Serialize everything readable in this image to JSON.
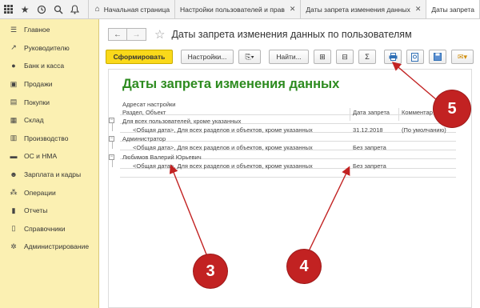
{
  "tabs": [
    {
      "label": "Начальная страница",
      "icon": "home-icon"
    },
    {
      "label": "Настройки пользователей и прав",
      "icon": "",
      "close": "✕"
    },
    {
      "label": "Даты запрета изменения данных",
      "icon": "",
      "close": "✕"
    },
    {
      "label": "Даты запрета",
      "icon": ""
    }
  ],
  "sidebar": {
    "items": [
      {
        "label": "Главное",
        "icon": "menu-icon"
      },
      {
        "label": "Руководителю",
        "icon": "trend-icon"
      },
      {
        "label": "Банк и касса",
        "icon": "coin-icon"
      },
      {
        "label": "Продажи",
        "icon": "cart-icon"
      },
      {
        "label": "Покупки",
        "icon": "basket-icon"
      },
      {
        "label": "Склад",
        "icon": "warehouse-icon"
      },
      {
        "label": "Производство",
        "icon": "production-icon"
      },
      {
        "label": "ОС и НМА",
        "icon": "assets-icon"
      },
      {
        "label": "Зарплата и кадры",
        "icon": "people-icon"
      },
      {
        "label": "Операции",
        "icon": "operations-icon"
      },
      {
        "label": "Отчеты",
        "icon": "reports-icon"
      },
      {
        "label": "Справочники",
        "icon": "books-icon"
      },
      {
        "label": "Администрирование",
        "icon": "gear-icon"
      }
    ]
  },
  "header": {
    "title": "Даты запрета изменения данных по пользователям"
  },
  "toolbar": {
    "generate_label": "Сформировать",
    "settings_label": "Настройки...",
    "find_label": "Найти...",
    "sum_label": "Σ"
  },
  "report": {
    "title": "Даты запрета изменения данных",
    "addressee_header": "Адресат настройки",
    "section_header": "Раздел, Объект",
    "date_header": "Дата запрета",
    "comment_header": "Комментар",
    "groups": [
      {
        "name": "Для всех пользователей, кроме указанных",
        "rows": [
          {
            "object": "<Общая дата>, Для всех разделов и объектов, кроме указанных",
            "date": "31.12.2018",
            "comment": "(По умолчанию)"
          }
        ]
      },
      {
        "name": "Администратор",
        "rows": [
          {
            "object": "<Общая дата>, Для всех разделов и объектов, кроме указанных",
            "date": "Без запрета",
            "comment": ""
          }
        ]
      },
      {
        "name": "Любимов Валерий Юрьевич",
        "rows": [
          {
            "object": "<Общая дата>, Для всех разделов и объектов, кроме указанных",
            "date": "Без запрета",
            "comment": ""
          }
        ]
      }
    ]
  },
  "annotations": {
    "badge3": "3",
    "badge4": "4",
    "badge5": "5"
  },
  "colors": {
    "accent": "#fad91a",
    "report_title": "#2d8b1f",
    "badge": "#c22222",
    "sidebar": "#fbf0b2"
  }
}
